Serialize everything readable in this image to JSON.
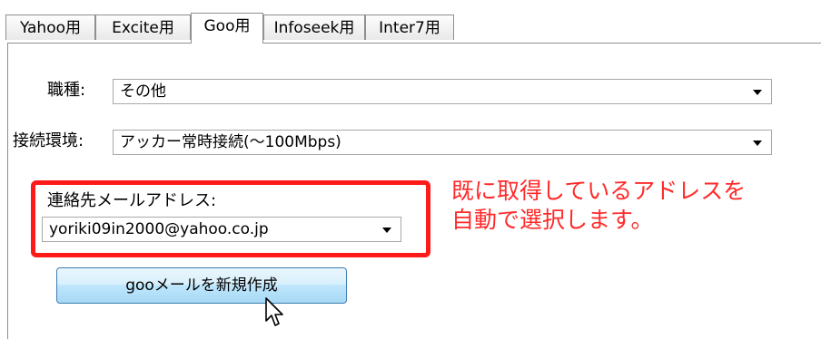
{
  "tabs": [
    {
      "label": "Yahoo用",
      "active": false
    },
    {
      "label": "Excite用",
      "active": false
    },
    {
      "label": "Goo用",
      "active": true
    },
    {
      "label": "Infoseek用",
      "active": false
    },
    {
      "label": "Inter7用",
      "active": false
    }
  ],
  "form": {
    "job_label": "職種:",
    "job_value": "その他",
    "conn_label": "接続環境:",
    "conn_value": "アッカー常時接続(〜100Mbps)",
    "email_label": "連絡先メールアドレス:",
    "email_value": "yoriki09in2000@yahoo.co.jp"
  },
  "note": {
    "line1": "既に取得しているアドレスを",
    "line2": "自動で選択します。"
  },
  "button": {
    "label": "gooメールを新規作成"
  },
  "colors": {
    "highlight": "#ff1a1a",
    "note_text": "#ff2a2a",
    "button_border": "#3c7fb1"
  },
  "icons": [
    "chevron-down-icon",
    "mouse-pointer-icon"
  ]
}
